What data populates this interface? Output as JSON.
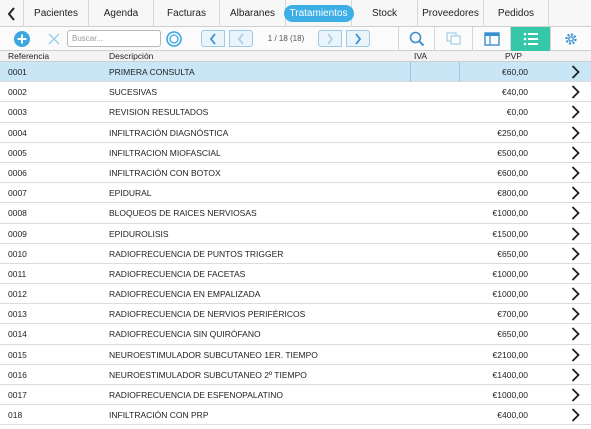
{
  "tabs": [
    {
      "label": "Pacientes",
      "active": false
    },
    {
      "label": "Agenda",
      "active": false
    },
    {
      "label": "Facturas",
      "active": false
    },
    {
      "label": "Albaranes",
      "active": false
    },
    {
      "label": "Tratamientos",
      "active": true
    },
    {
      "label": "Stock",
      "active": false
    },
    {
      "label": "Proveedores",
      "active": false
    },
    {
      "label": "Pedidos",
      "active": false
    }
  ],
  "toolbar": {
    "search_placeholder": "Buscar...",
    "page_counter": "1 / 18 (18)"
  },
  "table": {
    "columns": {
      "ref": "Referencia",
      "desc": "Descripción",
      "iva": "IVA",
      "pvp": "PVP"
    },
    "rows": [
      {
        "ref": "0001",
        "desc": "PRIMERA CONSULTA",
        "iva": "",
        "pvp": "€60,00",
        "selected": true
      },
      {
        "ref": "0002",
        "desc": "SUCESIVAS",
        "iva": "",
        "pvp": "€40,00"
      },
      {
        "ref": "0003",
        "desc": "REVISION RESULTADOS",
        "iva": "",
        "pvp": "€0,00"
      },
      {
        "ref": "0004",
        "desc": "INFILTRACIÓN DIAGNÓSTICA",
        "iva": "",
        "pvp": "€250,00"
      },
      {
        "ref": "0005",
        "desc": "INFILTRACION MIOFASCIAL",
        "iva": "",
        "pvp": "€500,00"
      },
      {
        "ref": "0006",
        "desc": "INFILTRACIÓN CON BOTOX",
        "iva": "",
        "pvp": "€600,00"
      },
      {
        "ref": "0007",
        "desc": "EPIDURAL",
        "iva": "",
        "pvp": "€800,00"
      },
      {
        "ref": "0008",
        "desc": "BLOQUEOS DE RAICES NERVIOSAS",
        "iva": "",
        "pvp": "€1000,00"
      },
      {
        "ref": "0009",
        "desc": "EPIDUROLISIS",
        "iva": "",
        "pvp": "€1500,00"
      },
      {
        "ref": "0010",
        "desc": "RADIOFRECUENCIA DE PUNTOS TRIGGER",
        "iva": "",
        "pvp": "€650,00"
      },
      {
        "ref": "0011",
        "desc": "RADIOFRECUENCIA DE FACETAS",
        "iva": "",
        "pvp": "€1000,00"
      },
      {
        "ref": "0012",
        "desc": "RADIOFRECUENCIA EN EMPALIZADA",
        "iva": "",
        "pvp": "€1000,00"
      },
      {
        "ref": "0013",
        "desc": "RADIOFRECUENCIA DE NERVIOS PERIFÉRICOS",
        "iva": "",
        "pvp": "€700,00"
      },
      {
        "ref": "0014",
        "desc": "RADIOFRECUENCIA SIN QUIRÓFANO",
        "iva": "",
        "pvp": "€650,00"
      },
      {
        "ref": "0015",
        "desc": "NEUROESTIMULADOR SUBCUTANEO 1ER. TIEMPO",
        "iva": "",
        "pvp": "€2100,00"
      },
      {
        "ref": "0016",
        "desc": "NEUROESTIMULADOR SUBCUTANEO 2º TIEMPO",
        "iva": "",
        "pvp": "€1400,00"
      },
      {
        "ref": "0017",
        "desc": "RADIOFRECUENCIA DE ESFENOPALATINO",
        "iva": "",
        "pvp": "€1000,00"
      },
      {
        "ref": "018",
        "desc": "INFILTRACIÓN CON PRP",
        "iva": "",
        "pvp": "€400,00"
      }
    ]
  },
  "colors": {
    "accent": "#3dafe6",
    "selected_row": "#c9e6f7",
    "active_view": "#35c7a8"
  },
  "icons": [
    "back-arrow-icon",
    "add-icon",
    "clear-icon",
    "search-icon",
    "chevron-left-icon",
    "chevron-right-icon",
    "duplicate-icon",
    "form-view-icon",
    "list-view-icon",
    "settings-icon",
    "row-detail-chevron-icon"
  ]
}
